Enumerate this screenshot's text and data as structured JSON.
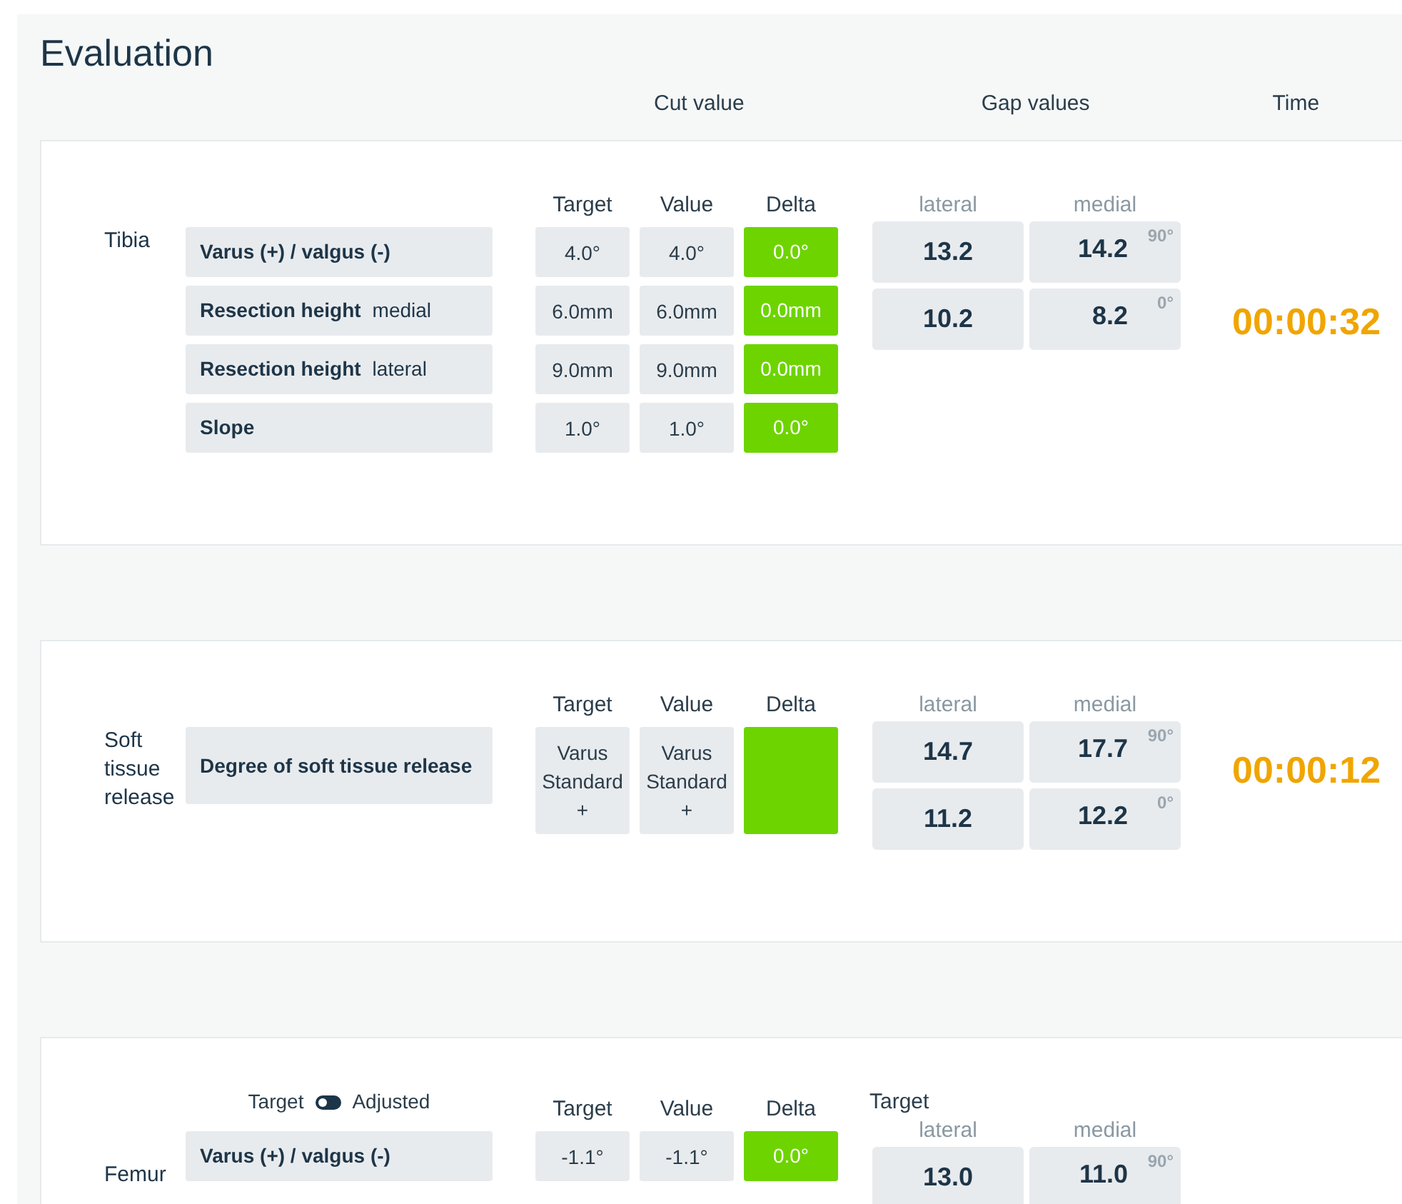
{
  "title": "Evaluation",
  "column_groups": [
    "Cut value",
    "Gap values",
    "Time"
  ],
  "sections": [
    {
      "name": "Tibia",
      "headers": [
        "Target",
        "Value",
        "Delta"
      ],
      "gap_headers": [
        "lateral",
        "medial"
      ],
      "rows": [
        {
          "label": "Varus (+) / valgus (-)",
          "target": "4.0°",
          "value": "4.0°",
          "delta": "0.0°",
          "color": "#6dd400"
        },
        {
          "label": "Resection height",
          "qualifier": "medial",
          "target": "6.0mm",
          "value": "6.0mm",
          "delta": "0.0mm",
          "color": "#6dd400"
        },
        {
          "label": "Resection height",
          "qualifier": "lateral",
          "target": "9.0mm",
          "value": "9.0mm",
          "delta": "0.0mm",
          "color": "#6dd400"
        },
        {
          "label": "Slope",
          "target": "1.0°",
          "value": "1.0°",
          "delta": "0.0°",
          "color": "#6dd400"
        }
      ],
      "gaps": [
        {
          "lateral": "13.2",
          "medial": "14.2",
          "angle": "90°"
        },
        {
          "lateral": "10.2",
          "medial": "8.2",
          "angle": "0°"
        }
      ],
      "time": "00:00:32"
    },
    {
      "name": "Soft tissue release",
      "headers": [
        "Target",
        "Value",
        "Delta"
      ],
      "gap_headers": [
        "lateral",
        "medial"
      ],
      "rows": [
        {
          "label": "Degree of soft tissue release",
          "target": "Varus Standard +",
          "value": "Varus Standard +",
          "color": "#6dd400"
        }
      ],
      "gaps": [
        {
          "lateral": "14.7",
          "medial": "17.7",
          "angle": "90°"
        },
        {
          "lateral": "11.2",
          "medial": "12.2",
          "angle": "0°"
        }
      ],
      "time": "00:00:12"
    },
    {
      "name": "Femur",
      "toggle": {
        "left": "Target",
        "right": "Adjusted",
        "on": false
      },
      "gap_title": "Target",
      "headers": [
        "Target",
        "Value",
        "Delta"
      ],
      "gap_headers": [
        "lateral",
        "medial"
      ],
      "rows": [
        {
          "label": "Varus (+) / valgus (-)",
          "target": "-1.1°",
          "value": "-1.1°",
          "delta": "0.0°",
          "color": "#6dd400"
        }
      ],
      "gaps": [
        {
          "lateral": "13.0",
          "medial": "11.0",
          "angle": "90°"
        }
      ]
    }
  ]
}
